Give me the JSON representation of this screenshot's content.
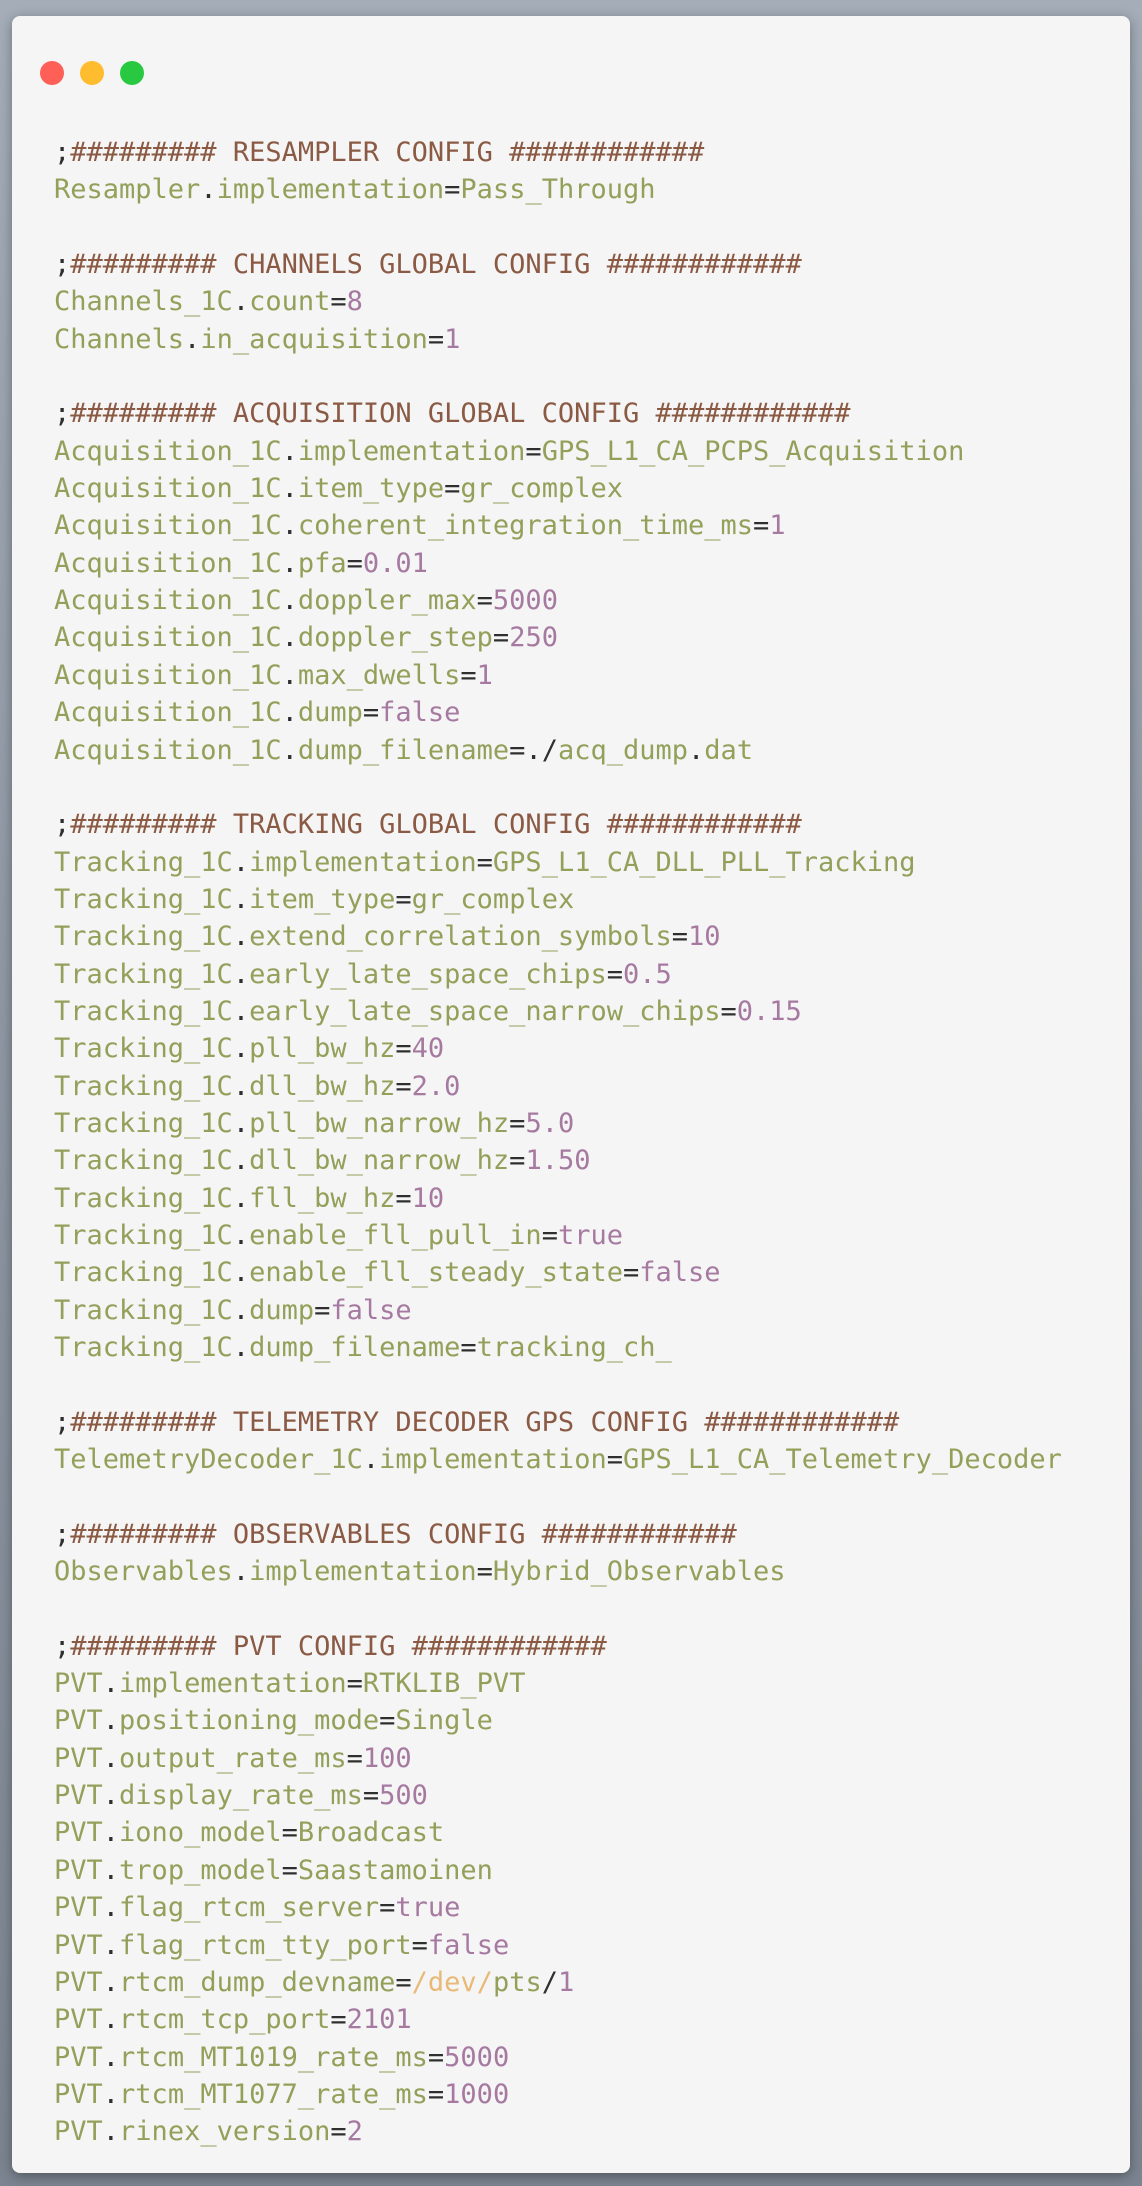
{
  "window": {
    "controls": [
      {
        "name": "close",
        "color": "#fe5f57"
      },
      {
        "name": "minimize",
        "color": "#febc2e"
      },
      {
        "name": "zoom",
        "color": "#28c840"
      }
    ]
  },
  "colors": {
    "comment": "#8a5a44",
    "key": "#93a05a",
    "number": "#a679a0",
    "punct": "#2f2f2f",
    "path": "#e8b978",
    "background": "#f5f5f5"
  },
  "lines": [
    [
      [
        ";",
        "p"
      ],
      [
        "######### RESAMPLER CONFIG ############",
        "c"
      ]
    ],
    [
      [
        "Resampler",
        "k"
      ],
      [
        ".",
        "p"
      ],
      [
        "implementation",
        "k"
      ],
      [
        "=",
        "p"
      ],
      [
        "Pass_Through",
        "k"
      ]
    ],
    [],
    [
      [
        ";",
        "p"
      ],
      [
        "######### CHANNELS GLOBAL CONFIG ############",
        "c"
      ]
    ],
    [
      [
        "Channels_1C",
        "k"
      ],
      [
        ".",
        "p"
      ],
      [
        "count",
        "k"
      ],
      [
        "=",
        "p"
      ],
      [
        "8",
        "n"
      ]
    ],
    [
      [
        "Channels",
        "k"
      ],
      [
        ".",
        "p"
      ],
      [
        "in_acquisition",
        "k"
      ],
      [
        "=",
        "p"
      ],
      [
        "1",
        "n"
      ]
    ],
    [],
    [
      [
        ";",
        "p"
      ],
      [
        "######### ACQUISITION GLOBAL CONFIG ############",
        "c"
      ]
    ],
    [
      [
        "Acquisition_1C",
        "k"
      ],
      [
        ".",
        "p"
      ],
      [
        "implementation",
        "k"
      ],
      [
        "=",
        "p"
      ],
      [
        "GPS_L1_CA_PCPS_Acquisition",
        "k"
      ]
    ],
    [
      [
        "Acquisition_1C",
        "k"
      ],
      [
        ".",
        "p"
      ],
      [
        "item_type",
        "k"
      ],
      [
        "=",
        "p"
      ],
      [
        "gr_complex",
        "k"
      ]
    ],
    [
      [
        "Acquisition_1C",
        "k"
      ],
      [
        ".",
        "p"
      ],
      [
        "coherent_integration_time_ms",
        "k"
      ],
      [
        "=",
        "p"
      ],
      [
        "1",
        "n"
      ]
    ],
    [
      [
        "Acquisition_1C",
        "k"
      ],
      [
        ".",
        "p"
      ],
      [
        "pfa",
        "k"
      ],
      [
        "=",
        "p"
      ],
      [
        "0.01",
        "n"
      ]
    ],
    [
      [
        "Acquisition_1C",
        "k"
      ],
      [
        ".",
        "p"
      ],
      [
        "doppler_max",
        "k"
      ],
      [
        "=",
        "p"
      ],
      [
        "5000",
        "n"
      ]
    ],
    [
      [
        "Acquisition_1C",
        "k"
      ],
      [
        ".",
        "p"
      ],
      [
        "doppler_step",
        "k"
      ],
      [
        "=",
        "p"
      ],
      [
        "250",
        "n"
      ]
    ],
    [
      [
        "Acquisition_1C",
        "k"
      ],
      [
        ".",
        "p"
      ],
      [
        "max_dwells",
        "k"
      ],
      [
        "=",
        "p"
      ],
      [
        "1",
        "n"
      ]
    ],
    [
      [
        "Acquisition_1C",
        "k"
      ],
      [
        ".",
        "p"
      ],
      [
        "dump",
        "k"
      ],
      [
        "=",
        "p"
      ],
      [
        "false",
        "n"
      ]
    ],
    [
      [
        "Acquisition_1C",
        "k"
      ],
      [
        ".",
        "p"
      ],
      [
        "dump_filename",
        "k"
      ],
      [
        "=",
        "p"
      ],
      [
        "./",
        "p"
      ],
      [
        "acq_dump",
        "k"
      ],
      [
        ".",
        "p"
      ],
      [
        "dat",
        "k"
      ]
    ],
    [],
    [
      [
        ";",
        "p"
      ],
      [
        "######### TRACKING GLOBAL CONFIG ############",
        "c"
      ]
    ],
    [
      [
        "Tracking_1C",
        "k"
      ],
      [
        ".",
        "p"
      ],
      [
        "implementation",
        "k"
      ],
      [
        "=",
        "p"
      ],
      [
        "GPS_L1_CA_DLL_PLL_Tracking",
        "k"
      ]
    ],
    [
      [
        "Tracking_1C",
        "k"
      ],
      [
        ".",
        "p"
      ],
      [
        "item_type",
        "k"
      ],
      [
        "=",
        "p"
      ],
      [
        "gr_complex",
        "k"
      ]
    ],
    [
      [
        "Tracking_1C",
        "k"
      ],
      [
        ".",
        "p"
      ],
      [
        "extend_correlation_symbols",
        "k"
      ],
      [
        "=",
        "p"
      ],
      [
        "10",
        "n"
      ]
    ],
    [
      [
        "Tracking_1C",
        "k"
      ],
      [
        ".",
        "p"
      ],
      [
        "early_late_space_chips",
        "k"
      ],
      [
        "=",
        "p"
      ],
      [
        "0.5",
        "n"
      ]
    ],
    [
      [
        "Tracking_1C",
        "k"
      ],
      [
        ".",
        "p"
      ],
      [
        "early_late_space_narrow_chips",
        "k"
      ],
      [
        "=",
        "p"
      ],
      [
        "0.15",
        "n"
      ]
    ],
    [
      [
        "Tracking_1C",
        "k"
      ],
      [
        ".",
        "p"
      ],
      [
        "pll_bw_hz",
        "k"
      ],
      [
        "=",
        "p"
      ],
      [
        "40",
        "n"
      ]
    ],
    [
      [
        "Tracking_1C",
        "k"
      ],
      [
        ".",
        "p"
      ],
      [
        "dll_bw_hz",
        "k"
      ],
      [
        "=",
        "p"
      ],
      [
        "2.0",
        "n"
      ]
    ],
    [
      [
        "Tracking_1C",
        "k"
      ],
      [
        ".",
        "p"
      ],
      [
        "pll_bw_narrow_hz",
        "k"
      ],
      [
        "=",
        "p"
      ],
      [
        "5.0",
        "n"
      ]
    ],
    [
      [
        "Tracking_1C",
        "k"
      ],
      [
        ".",
        "p"
      ],
      [
        "dll_bw_narrow_hz",
        "k"
      ],
      [
        "=",
        "p"
      ],
      [
        "1.50",
        "n"
      ]
    ],
    [
      [
        "Tracking_1C",
        "k"
      ],
      [
        ".",
        "p"
      ],
      [
        "fll_bw_hz",
        "k"
      ],
      [
        "=",
        "p"
      ],
      [
        "10",
        "n"
      ]
    ],
    [
      [
        "Tracking_1C",
        "k"
      ],
      [
        ".",
        "p"
      ],
      [
        "enable_fll_pull_in",
        "k"
      ],
      [
        "=",
        "p"
      ],
      [
        "true",
        "n"
      ]
    ],
    [
      [
        "Tracking_1C",
        "k"
      ],
      [
        ".",
        "p"
      ],
      [
        "enable_fll_steady_state",
        "k"
      ],
      [
        "=",
        "p"
      ],
      [
        "false",
        "n"
      ]
    ],
    [
      [
        "Tracking_1C",
        "k"
      ],
      [
        ".",
        "p"
      ],
      [
        "dump",
        "k"
      ],
      [
        "=",
        "p"
      ],
      [
        "false",
        "n"
      ]
    ],
    [
      [
        "Tracking_1C",
        "k"
      ],
      [
        ".",
        "p"
      ],
      [
        "dump_filename",
        "k"
      ],
      [
        "=",
        "p"
      ],
      [
        "tracking_ch_",
        "k"
      ]
    ],
    [],
    [
      [
        ";",
        "p"
      ],
      [
        "######### TELEMETRY DECODER GPS CONFIG ############",
        "c"
      ]
    ],
    [
      [
        "TelemetryDecoder_1C",
        "k"
      ],
      [
        ".",
        "p"
      ],
      [
        "implementation",
        "k"
      ],
      [
        "=",
        "p"
      ],
      [
        "GPS_L1_CA_Telemetry_Decoder",
        "k"
      ]
    ],
    [],
    [
      [
        ";",
        "p"
      ],
      [
        "######### OBSERVABLES CONFIG ############",
        "c"
      ]
    ],
    [
      [
        "Observables",
        "k"
      ],
      [
        ".",
        "p"
      ],
      [
        "implementation",
        "k"
      ],
      [
        "=",
        "p"
      ],
      [
        "Hybrid_Observables",
        "k"
      ]
    ],
    [],
    [
      [
        ";",
        "p"
      ],
      [
        "######### PVT CONFIG ############",
        "c"
      ]
    ],
    [
      [
        "PVT",
        "k"
      ],
      [
        ".",
        "p"
      ],
      [
        "implementation",
        "k"
      ],
      [
        "=",
        "p"
      ],
      [
        "RTKLIB_PVT",
        "k"
      ]
    ],
    [
      [
        "PVT",
        "k"
      ],
      [
        ".",
        "p"
      ],
      [
        "positioning_mode",
        "k"
      ],
      [
        "=",
        "p"
      ],
      [
        "Single",
        "k"
      ]
    ],
    [
      [
        "PVT",
        "k"
      ],
      [
        ".",
        "p"
      ],
      [
        "output_rate_ms",
        "k"
      ],
      [
        "=",
        "p"
      ],
      [
        "100",
        "n"
      ]
    ],
    [
      [
        "PVT",
        "k"
      ],
      [
        ".",
        "p"
      ],
      [
        "display_rate_ms",
        "k"
      ],
      [
        "=",
        "p"
      ],
      [
        "500",
        "n"
      ]
    ],
    [
      [
        "PVT",
        "k"
      ],
      [
        ".",
        "p"
      ],
      [
        "iono_model",
        "k"
      ],
      [
        "=",
        "p"
      ],
      [
        "Broadcast",
        "k"
      ]
    ],
    [
      [
        "PVT",
        "k"
      ],
      [
        ".",
        "p"
      ],
      [
        "trop_model",
        "k"
      ],
      [
        "=",
        "p"
      ],
      [
        "Saastamoinen",
        "k"
      ]
    ],
    [
      [
        "PVT",
        "k"
      ],
      [
        ".",
        "p"
      ],
      [
        "flag_rtcm_server",
        "k"
      ],
      [
        "=",
        "p"
      ],
      [
        "true",
        "n"
      ]
    ],
    [
      [
        "PVT",
        "k"
      ],
      [
        ".",
        "p"
      ],
      [
        "flag_rtcm_tty_port",
        "k"
      ],
      [
        "=",
        "p"
      ],
      [
        "false",
        "n"
      ]
    ],
    [
      [
        "PVT",
        "k"
      ],
      [
        ".",
        "p"
      ],
      [
        "rtcm_dump_devname",
        "k"
      ],
      [
        "=",
        "p"
      ],
      [
        "/dev/",
        "o"
      ],
      [
        "pts",
        "k"
      ],
      [
        "/",
        "p"
      ],
      [
        "1",
        "n"
      ]
    ],
    [
      [
        "PVT",
        "k"
      ],
      [
        ".",
        "p"
      ],
      [
        "rtcm_tcp_port",
        "k"
      ],
      [
        "=",
        "p"
      ],
      [
        "2101",
        "n"
      ]
    ],
    [
      [
        "PVT",
        "k"
      ],
      [
        ".",
        "p"
      ],
      [
        "rtcm_MT1019_rate_ms",
        "k"
      ],
      [
        "=",
        "p"
      ],
      [
        "5000",
        "n"
      ]
    ],
    [
      [
        "PVT",
        "k"
      ],
      [
        ".",
        "p"
      ],
      [
        "rtcm_MT1077_rate_ms",
        "k"
      ],
      [
        "=",
        "p"
      ],
      [
        "1000",
        "n"
      ]
    ],
    [
      [
        "PVT",
        "k"
      ],
      [
        ".",
        "p"
      ],
      [
        "rinex_version",
        "k"
      ],
      [
        "=",
        "p"
      ],
      [
        "2",
        "n"
      ]
    ]
  ]
}
